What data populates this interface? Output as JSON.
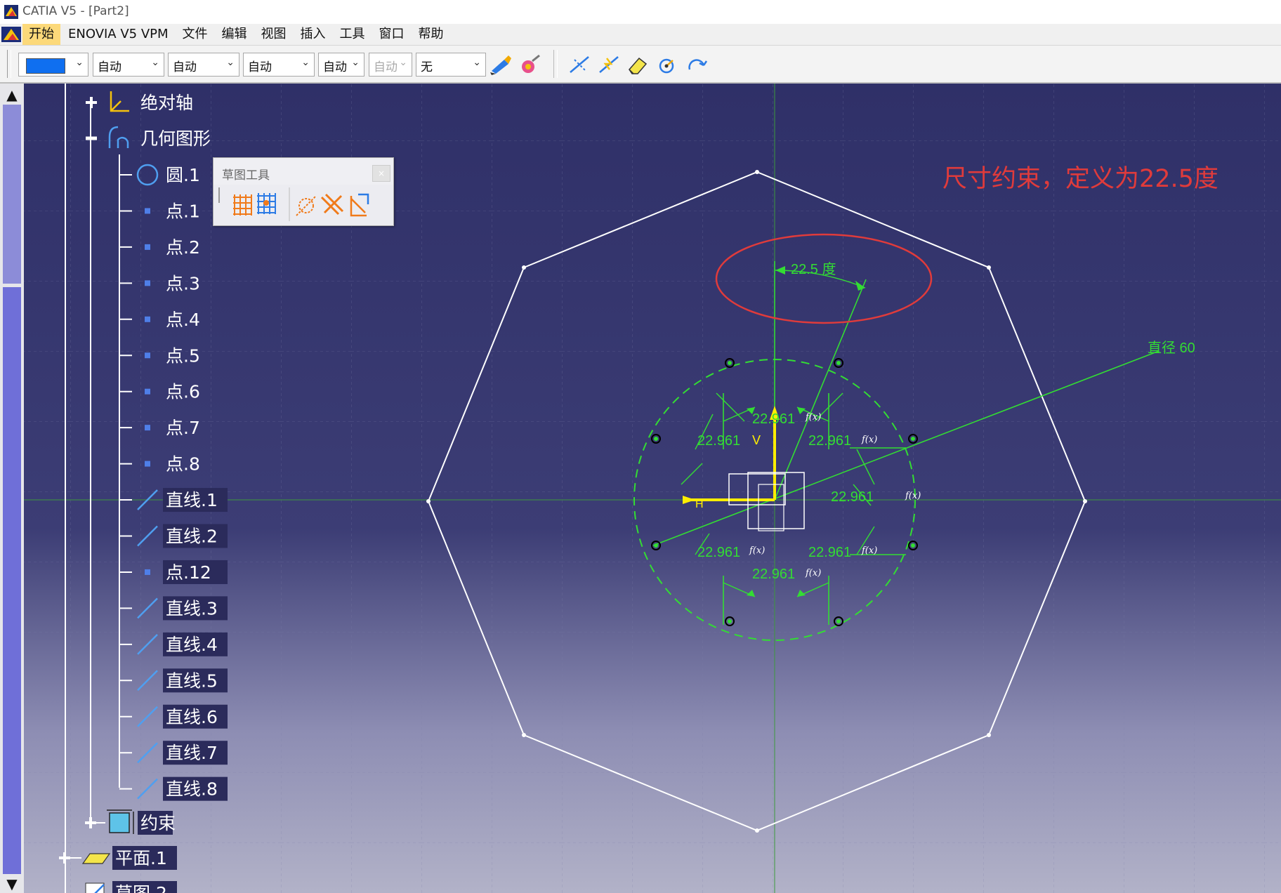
{
  "window": {
    "title": "CATIA V5 - [Part2]"
  },
  "menu": {
    "items": [
      "开始",
      "ENOVIA V5 VPM",
      "文件",
      "编辑",
      "视图",
      "插入",
      "工具",
      "窗口",
      "帮助"
    ],
    "active": "开始"
  },
  "toolbar": {
    "color": "#0f6ff0",
    "dropdowns": [
      "自动",
      "自动",
      "自动",
      "自动",
      "自动",
      "无"
    ]
  },
  "tree": {
    "items": [
      {
        "label": "绝对轴",
        "icon": "axis-system-icon"
      },
      {
        "label": "几何图形",
        "icon": "geometry-icon"
      },
      {
        "label": "圆.1",
        "icon": "circle-icon"
      },
      {
        "label": "点.1",
        "icon": "point-icon"
      },
      {
        "label": "点.2",
        "icon": "point-icon"
      },
      {
        "label": "点.3",
        "icon": "point-icon"
      },
      {
        "label": "点.4",
        "icon": "point-icon"
      },
      {
        "label": "点.5",
        "icon": "point-icon"
      },
      {
        "label": "点.6",
        "icon": "point-icon"
      },
      {
        "label": "点.7",
        "icon": "point-icon"
      },
      {
        "label": "点.8",
        "icon": "point-icon"
      },
      {
        "label": "直线.1",
        "icon": "line-icon"
      },
      {
        "label": "直线.2",
        "icon": "line-icon"
      },
      {
        "label": "点.12",
        "icon": "point-icon"
      },
      {
        "label": "直线.3",
        "icon": "line-icon"
      },
      {
        "label": "直线.4",
        "icon": "line-icon"
      },
      {
        "label": "直线.5",
        "icon": "line-icon"
      },
      {
        "label": "直线.6",
        "icon": "line-icon"
      },
      {
        "label": "直线.7",
        "icon": "line-icon"
      },
      {
        "label": "直线.8",
        "icon": "line-icon"
      },
      {
        "label": "约束",
        "icon": "constraints-icon"
      },
      {
        "label": "平面.1",
        "icon": "plane-icon"
      },
      {
        "label": "草图.2",
        "icon": "sketch-icon"
      }
    ]
  },
  "sketch_tools": {
    "title": "草图工具"
  },
  "annotation": {
    "text": "尺寸约束，定义为22.5度",
    "color": "#e03b3b"
  },
  "dimensions": {
    "angle": "22.5 度",
    "diameter": "直径 60",
    "arc": "22.961",
    "fix_symbol": "f(x)"
  },
  "colors": {
    "sketch": "#33dd33",
    "geometry": "#ffffff",
    "highlight": "#e03b3b",
    "axis": "#ffee00"
  }
}
